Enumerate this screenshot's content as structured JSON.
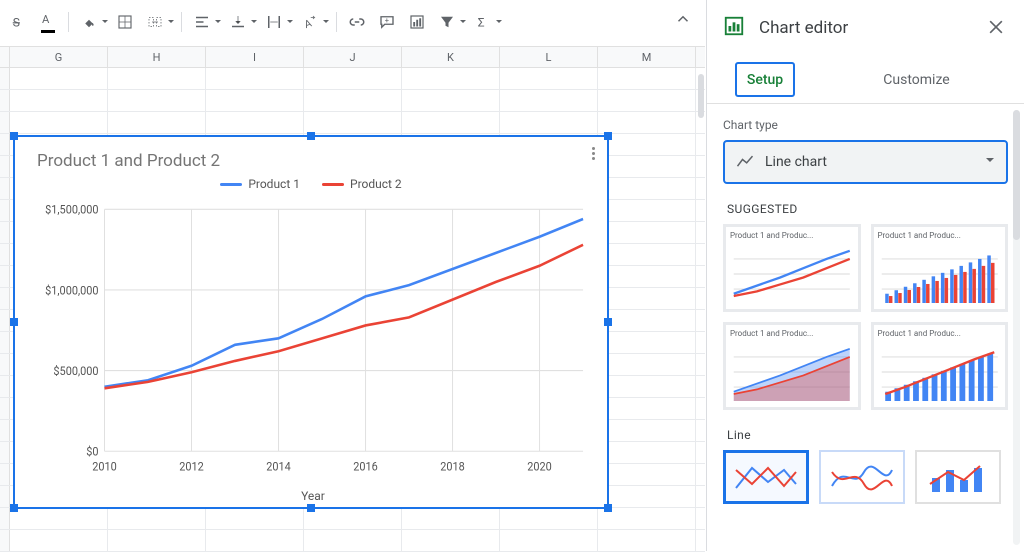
{
  "toolbar": {
    "strikethrough": "Strikethrough",
    "text_color": "Text color",
    "fill_color": "Fill color",
    "borders": "Borders",
    "merge": "Merge cells",
    "halign": "Horizontal align",
    "valign": "Vertical align",
    "wrap": "Text wrapping",
    "rotate": "Text rotation",
    "link": "Insert link",
    "comment": "Insert comment",
    "chart": "Insert chart",
    "filter": "Create filter",
    "functions": "Functions",
    "collapse": "Collapse"
  },
  "sheet": {
    "columns": [
      "G",
      "H",
      "I",
      "J",
      "K",
      "L",
      "M"
    ]
  },
  "chart_data": {
    "type": "line",
    "title": "Product 1 and Product 2",
    "xlabel": "Year",
    "ylabel": "",
    "categories": [
      2010,
      2011,
      2012,
      2013,
      2014,
      2015,
      2016,
      2017,
      2018,
      2019,
      2020,
      2021
    ],
    "x_ticks": [
      2010,
      2012,
      2014,
      2016,
      2018,
      2020
    ],
    "y_ticks": [
      0,
      500000,
      1000000,
      1500000
    ],
    "y_tick_labels": [
      "$0",
      "$500,000",
      "$1,000,000",
      "$1,500,000"
    ],
    "ylim": [
      0,
      1500000
    ],
    "series": [
      {
        "name": "Product 1",
        "color": "#4285f4",
        "values": [
          400000,
          440000,
          530000,
          660000,
          700000,
          820000,
          960000,
          1030000,
          1130000,
          1230000,
          1330000,
          1440000
        ]
      },
      {
        "name": "Product 2",
        "color": "#ea4335",
        "values": [
          390000,
          430000,
          490000,
          560000,
          620000,
          700000,
          780000,
          830000,
          940000,
          1050000,
          1150000,
          1280000
        ]
      }
    ]
  },
  "editor": {
    "title": "Chart editor",
    "tabs": {
      "setup": "Setup",
      "customize": "Customize"
    },
    "chart_type_label": "Chart type",
    "chart_type_value": "Line chart",
    "suggested": "SUGGESTED",
    "sugg_title": "Product 1 and Produc...",
    "line": "Line"
  }
}
